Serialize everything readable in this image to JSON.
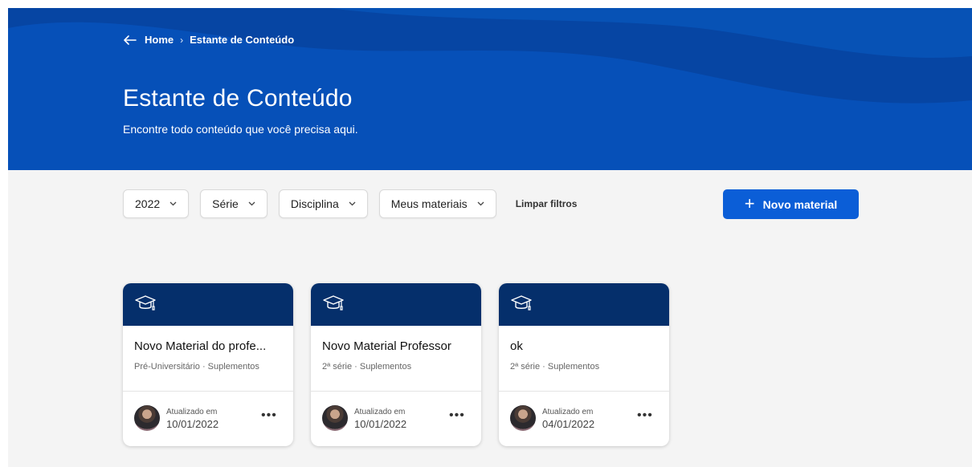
{
  "breadcrumb": {
    "home": "Home",
    "separator": "›",
    "current": "Estante de Conteúdo"
  },
  "header": {
    "title": "Estante de Conteúdo",
    "subtitle": "Encontre todo conteúdo que você precisa aqui."
  },
  "filters": {
    "year": "2022",
    "serie": "Série",
    "disciplina": "Disciplina",
    "meus_materiais": "Meus materiais",
    "clear": "Limpar filtros"
  },
  "actions": {
    "new_material": "Novo material"
  },
  "colors": {
    "hero": "#0650b8",
    "card_header": "#052f6b",
    "primary_button": "#0b5ed7"
  },
  "cards": [
    {
      "title": "Novo Material do profe...",
      "meta": "Pré-Universitário · Suplementos",
      "updated_label": "Atualizado em",
      "date": "10/01/2022",
      "more": "•••"
    },
    {
      "title": "Novo Material Professor",
      "meta": "2ª série · Suplementos",
      "updated_label": "Atualizado em",
      "date": "10/01/2022",
      "more": "•••"
    },
    {
      "title": "ok",
      "meta": "2ª série · Suplementos",
      "updated_label": "Atualizado em",
      "date": "04/01/2022",
      "more": "•••"
    }
  ]
}
